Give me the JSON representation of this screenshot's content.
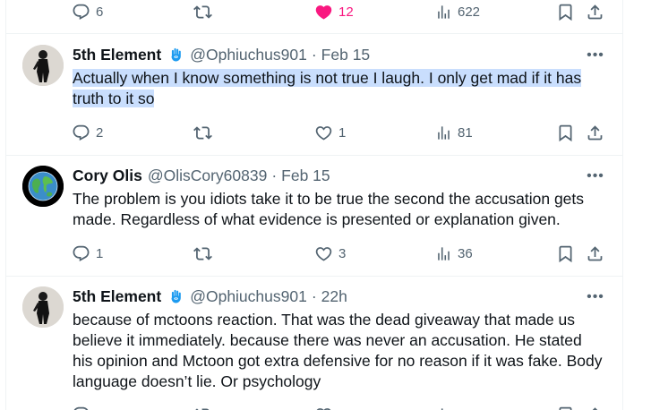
{
  "top_actions": {
    "replies": "6",
    "retweets": "",
    "likes": "12",
    "views": "622"
  },
  "posts": [
    {
      "name": "5th Element",
      "handle": "@Ophiuchus901",
      "sep": "·",
      "time": "Feb 15",
      "text_highlighted": "Actually when I know something is not true I laugh. I only get mad if it has truth to it so",
      "replies": "2",
      "retweets": "",
      "likes": "1",
      "views": "81"
    },
    {
      "name": "Cory Olis",
      "handle": "@OlisCory60839",
      "sep": "·",
      "time": "Feb 15",
      "text": "The problem is you idiots take it to be true the second the accusation gets made. Regardless of what evidence is presented or explanation given.",
      "replies": "1",
      "retweets": "",
      "likes": "3",
      "views": "36"
    },
    {
      "name": "5th Element",
      "handle": "@Ophiuchus901",
      "sep": "·",
      "time": "22h",
      "text": "because of mctoons reaction. That was the dead giveaway that made us believe it immediately. because there was never an accusation. He stated his opinion and Mctoon got extra defensive for no reason if it was fake. Body language doesn’t lie. Or psychology"
    }
  ],
  "more_glyph": "•••",
  "icons": [
    "reply-icon",
    "retweet-icon",
    "like-icon",
    "views-icon",
    "bookmark-icon",
    "share-icon",
    "more-icon",
    "hamsa-badge-icon"
  ],
  "colors": {
    "text": "#0f1419",
    "muted": "#536471",
    "like_active": "#f91880",
    "highlight": "#c9defd",
    "border": "#eff3f4",
    "badge": "#1d9bf0"
  }
}
